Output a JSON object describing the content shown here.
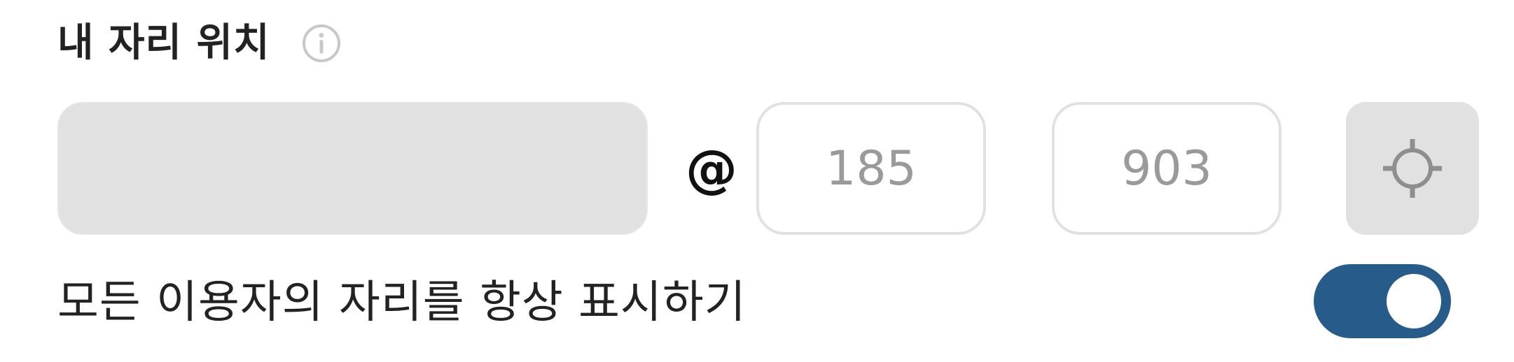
{
  "section": {
    "title": "내 자리 위치",
    "info_icon": "info-circle-icon"
  },
  "position": {
    "name_value": "",
    "at_symbol": "@",
    "x_value": "185",
    "y_value": "903",
    "locate_icon": "crosshair-icon"
  },
  "visibility": {
    "label": "모든 이용자의 자리를 항상 표시하기",
    "enabled": true
  },
  "colors": {
    "toggle_on": "#275b89",
    "field_gray": "#e1e1e1",
    "icon_gray": "#8e8e8e",
    "info_gray": "#c8c8c8"
  }
}
